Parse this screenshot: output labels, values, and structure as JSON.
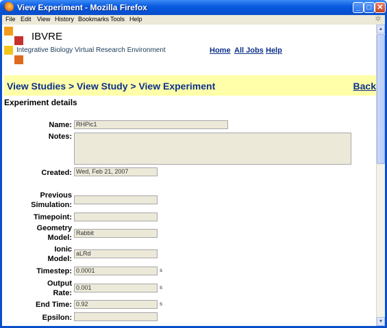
{
  "window": {
    "title": "View Experiment - Mozilla Firefox",
    "minimize": "_",
    "maximize": "□",
    "close": "✕"
  },
  "menu": [
    "File",
    "Edit",
    "View",
    "History",
    "Bookmarks",
    "Tools",
    "Help"
  ],
  "logo": {
    "title": "IBVRE",
    "subtitle": "Integrative Biology Virtual Research Environment",
    "colors": [
      "#f39c1c",
      "#c8302c",
      "#f3c41c",
      "#e06a1c"
    ]
  },
  "nav": {
    "home": "Home",
    "all_jobs": "All Jobs",
    "help": "Help"
  },
  "breadcrumb": {
    "text": "View Studies > View Study > View Experiment",
    "back": "Back"
  },
  "section_title": "Experiment details",
  "fields": {
    "name": {
      "label": "Name:",
      "value": "RHPic1"
    },
    "notes": {
      "label": "Notes:",
      "value": ""
    },
    "created": {
      "label": "Created:",
      "value": "Wed, Feb 21, 2007"
    },
    "previous_simulation": {
      "label_line1": "Previous",
      "label_line2": "Simulation:",
      "value": ""
    },
    "timepoint": {
      "label": "Timepoint:",
      "value": ""
    },
    "geometry_model": {
      "label_line1": "Geometry",
      "label_line2": "Model:",
      "value": "Rabbit"
    },
    "ionic_model": {
      "label_line1": "Ionic",
      "label_line2": "Model:",
      "value": "aLRd"
    },
    "timestep": {
      "label": "Timestep:",
      "value": "0.0001",
      "unit": "s"
    },
    "output_rate": {
      "label_line1": "Output",
      "label_line2": "Rate:",
      "value": "0.001",
      "unit": "s"
    },
    "end_time": {
      "label": "End Time:",
      "value": "0.92",
      "unit": "s"
    },
    "epsilon": {
      "label": "Epsilon:",
      "value": ""
    }
  },
  "scrollbar": {
    "up": "▲",
    "down": "▼",
    "throbber": "✲"
  }
}
